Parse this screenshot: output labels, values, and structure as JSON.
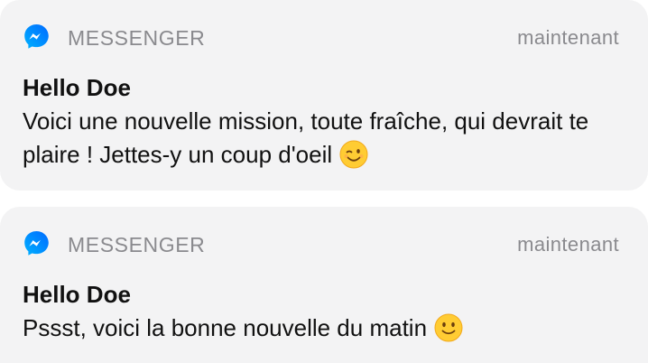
{
  "notifications": [
    {
      "app_name": "MESSENGER",
      "timestamp": "maintenant",
      "title": "Hello Doe",
      "message": "Voici une nouvelle mission, toute fraîche, qui devrait te plaire ! Jettes-y un coup d'oeil",
      "emoji": "winking-face-emoji",
      "app_icon": "messenger-icon"
    },
    {
      "app_name": "MESSENGER",
      "timestamp": "maintenant",
      "title": "Hello Doe",
      "message": "Pssst, voici la bonne nouvelle du matin",
      "emoji": "slightly-smiling-face-emoji",
      "app_icon": "messenger-icon"
    }
  ],
  "colors": {
    "card_background": "#f3f3f4",
    "muted_text": "#8a8a8e",
    "primary_text": "#111111",
    "messenger_gradient_start": "#00b2ff",
    "messenger_gradient_end": "#006aff",
    "emoji_yellow": "#ffcc33"
  }
}
